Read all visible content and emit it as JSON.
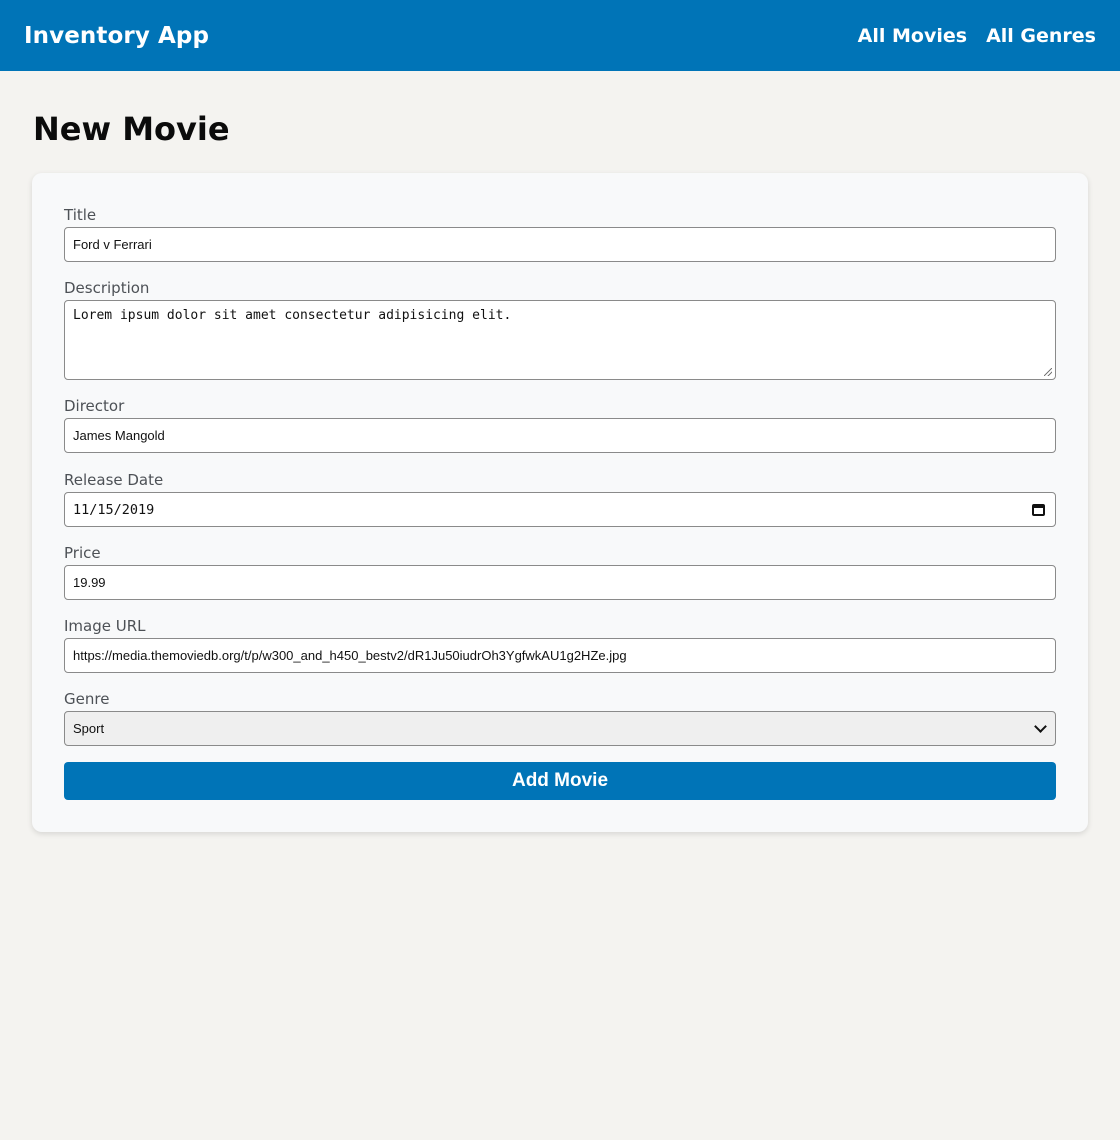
{
  "header": {
    "brand": "Inventory App",
    "nav": [
      {
        "label": "All Movies"
      },
      {
        "label": "All Genres"
      }
    ]
  },
  "page": {
    "title": "New Movie"
  },
  "form": {
    "title": {
      "label": "Title",
      "value": "Ford v Ferrari"
    },
    "description": {
      "label": "Description",
      "value": "Lorem ipsum dolor sit amet consectetur adipisicing elit."
    },
    "director": {
      "label": "Director",
      "value": "James Mangold"
    },
    "release_date": {
      "label": "Release Date",
      "value": "11/15/2019"
    },
    "price": {
      "label": "Price",
      "value": "19.99"
    },
    "image_url": {
      "label": "Image URL",
      "value": "https://media.themoviedb.org/t/p/w300_and_h450_bestv2/dR1Ju50iudrOh3YgfwkAU1g2HZe.jpg"
    },
    "genre": {
      "label": "Genre",
      "selected": "Sport"
    },
    "submit_label": "Add Movie"
  },
  "colors": {
    "accent": "#0074b7",
    "page_background": "#f4f3f0",
    "card_background": "#f8f9fa"
  },
  "icons": {
    "date_picker": "calendar-icon",
    "select_toggle": "chevron-down-icon"
  }
}
